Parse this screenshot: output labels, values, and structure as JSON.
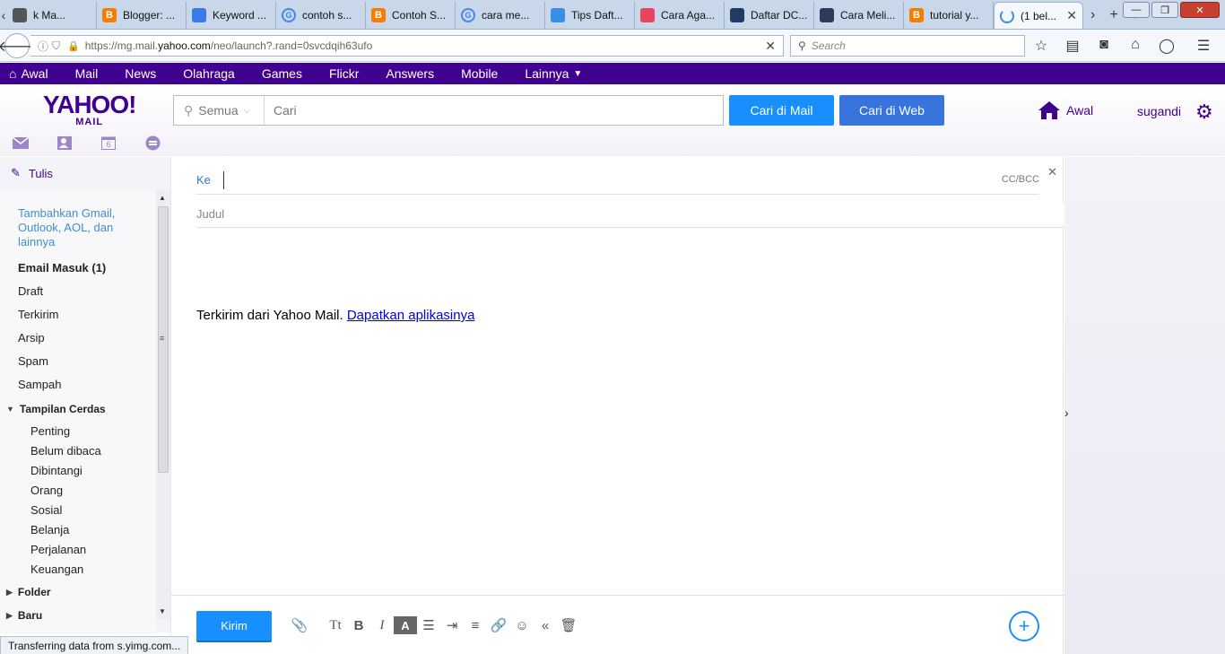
{
  "browser": {
    "tabs": [
      {
        "title": "k Ma...",
        "icon": "page-icon",
        "color": "#555555"
      },
      {
        "title": "Blogger: ...",
        "icon": "blogger-icon",
        "color": "#f57d00"
      },
      {
        "title": "Keyword ...",
        "icon": "adwords-icon",
        "color": "#3b7be8"
      },
      {
        "title": "contoh s...",
        "icon": "google-icon",
        "color": "#4285f4"
      },
      {
        "title": "Contoh S...",
        "icon": "blogger-icon",
        "color": "#f57d00"
      },
      {
        "title": "cara me...",
        "icon": "google-icon",
        "color": "#4285f4"
      },
      {
        "title": "Tips Daft...",
        "icon": "gear-icon",
        "color": "#3a8ee6"
      },
      {
        "title": "Cara Aga...",
        "icon": "colorful-icon",
        "color": "#e94560"
      },
      {
        "title": "Daftar DC...",
        "icon": "circle-icon",
        "color": "#1f3b66"
      },
      {
        "title": "Cara Meli...",
        "icon": "grid-icon",
        "color": "#2a3c5a"
      },
      {
        "title": "tutorial y...",
        "icon": "blogger-icon",
        "color": "#f57d00"
      },
      {
        "title": "(1 bel...",
        "icon": "loading-icon",
        "color": "#3a8ee6",
        "active": true
      }
    ],
    "url": {
      "prefix": "https://mg.mail.",
      "domain": "yahoo.com",
      "path": "/neo/launch?.rand=0svcdqih63ufo"
    },
    "search_placeholder": "Search",
    "status": "Transferring data from s.yimg.com..."
  },
  "yahoo_nav": {
    "items": [
      "Awal",
      "Mail",
      "News",
      "Olahraga",
      "Games",
      "Flickr",
      "Answers",
      "Mobile",
      "Lainnya"
    ],
    "bg_color": "#400090"
  },
  "header": {
    "logo_main": "YAHOO!",
    "logo_sub": "MAIL",
    "search_scope": "Semua",
    "search_placeholder": "Cari",
    "btn_mail": "Cari di Mail",
    "btn_web": "Cari di Web",
    "home_label": "Awal",
    "username": "sugandi",
    "calendar_day": "6",
    "accent_color": "#188fff"
  },
  "sidebar": {
    "compose_label": "Tulis",
    "add_accounts": "Tambahkan Gmail, Outlook, AOL, dan lainnya",
    "folders": [
      {
        "label": "Email Masuk (1)",
        "bold": true
      },
      {
        "label": "Draft"
      },
      {
        "label": "Terkirim"
      },
      {
        "label": "Arsip"
      },
      {
        "label": "Spam"
      },
      {
        "label": "Sampah"
      }
    ],
    "smart_views_label": "Tampilan Cerdas",
    "smart_views": [
      "Penting",
      "Belum dibaca",
      "Dibintangi",
      "Orang",
      "Sosial",
      "Belanja",
      "Perjalanan",
      "Keuangan"
    ],
    "folder_section": "Folder",
    "recent_section": "Baru"
  },
  "compose": {
    "to_label": "Ke",
    "ccbcc": "CC/BCC",
    "subject_placeholder": "Judul",
    "signature_text": "Terkirim dari Yahoo Mail. ",
    "signature_link": "Dapatkan aplikasinya",
    "send_label": "Kirim"
  }
}
